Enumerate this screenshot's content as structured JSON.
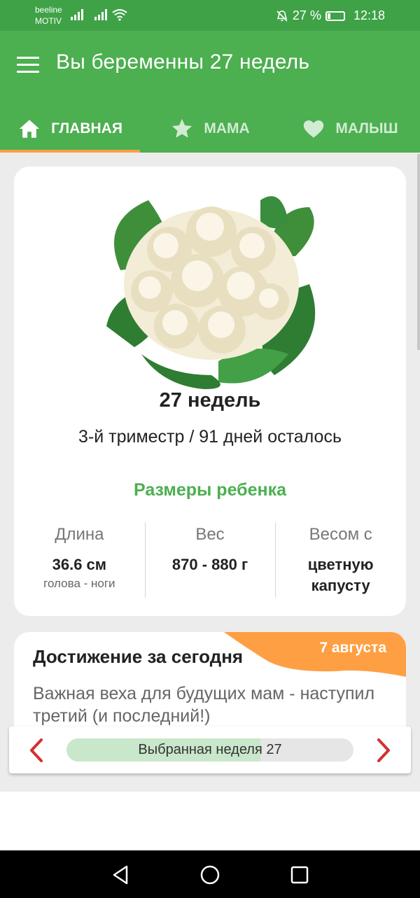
{
  "status_bar": {
    "carrier_line1": "beeline",
    "carrier_line2": "MOTIV",
    "battery_percent": "27 %",
    "battery_level": 0.27,
    "time": "12:18"
  },
  "app_bar": {
    "title": "Вы беременны 27 недель",
    "tabs": [
      {
        "label": "ГЛАВНАЯ",
        "icon": "home-icon",
        "active": true
      },
      {
        "label": "МАМА",
        "icon": "star-icon",
        "active": false
      },
      {
        "label": "МАЛЫШ",
        "icon": "heart-icon",
        "active": false
      }
    ]
  },
  "week_card": {
    "image": "cauliflower-image",
    "weeks": "27 недель",
    "trimester": "3-й триместр / 91 дней осталось",
    "sizes_title": "Размеры ребенка",
    "stats": [
      {
        "label": "Длина",
        "value": "36.6 см",
        "sub": "голова - ноги"
      },
      {
        "label": "Вес",
        "value": "870 - 880 г",
        "sub": ""
      },
      {
        "label": "Весом с",
        "value": "цветную капусту",
        "sub": ""
      }
    ]
  },
  "achievement": {
    "title": "Достижение за сегодня",
    "date": "7 августа",
    "text": "Важная веха для будущих мам - наступил третий (и последний!)"
  },
  "week_selector": {
    "label": "Выбранная неделя 27",
    "progress": 0.675
  },
  "colors": {
    "status_bar": "#3fa247",
    "app_bar": "#4caf50",
    "accent_orange": "#ff9f43",
    "arrow_red": "#d32f2f"
  }
}
